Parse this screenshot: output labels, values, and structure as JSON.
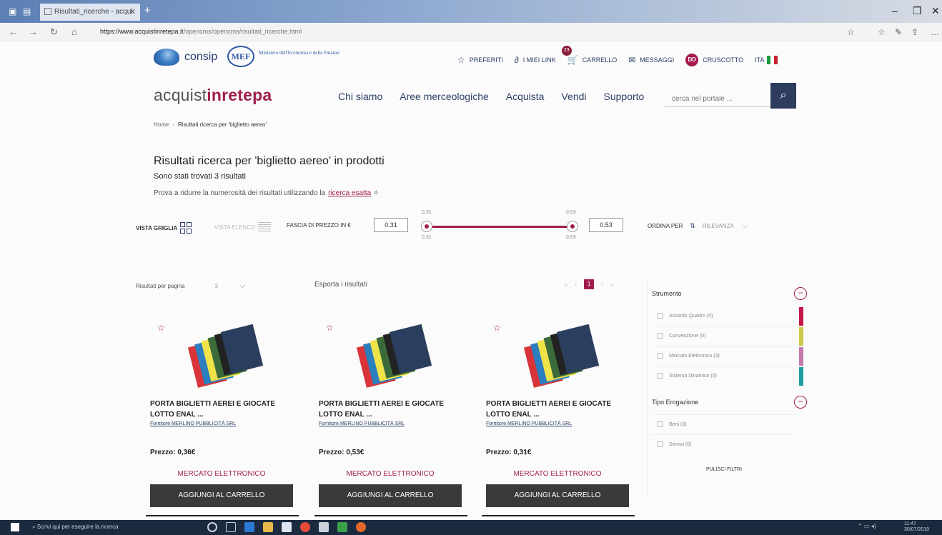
{
  "browser": {
    "tab_title": "Risultati_ricerche - acqui",
    "url_host": "https://www.acquistinretepa.it",
    "url_path": "/opencms/opencms/risultati_ricerche.html"
  },
  "header": {
    "consip": "consip",
    "mef": "MEF",
    "mef_caption": "Ministero dell'Economia e delle Finanze",
    "links": {
      "preferiti": "PREFERITI",
      "link": "I MIEI LINK",
      "carrello": "CARRELLO",
      "carrello_count": "23",
      "messaggi": "MESSAGGI",
      "user_initials": "DD",
      "cruscotto": "CRUSCOTTO",
      "lang": "ITA"
    },
    "brand_a": "acquist",
    "brand_b": "inrete",
    "brand_c": "pa",
    "nav": [
      "Chi siamo",
      "Aree merceologiche",
      "Acquista",
      "Vendi",
      "Supporto"
    ],
    "search_placeholder": "cerca nel portale ..."
  },
  "breadcrumb": {
    "home": "Home",
    "current": "Risultati ricerca per 'biglietto aereo'"
  },
  "results": {
    "title": "Risultati ricerca per 'biglietto aereo' in prodotti",
    "count": "Sono stati trovati 3 risultati",
    "refine_text": "Prova a ridurre la numerosità dei risultati utilizzando la",
    "refine_link": "ricerca esatta"
  },
  "toolbar": {
    "vista_griglia": "VISTA GRIGLIA",
    "vista_elenco": "VISTA ELENCO",
    "fascia": "FASCIA DI PREZZO IN €",
    "price_min": "0.31",
    "price_max": "0.53",
    "min_top": "0,31",
    "min_bottom": "0,31",
    "max_top": "0,53",
    "max_bottom": "0,53",
    "ordina": "ORDINA PER",
    "ordina_value": "RILEVANZA"
  },
  "listing": {
    "per_page_label": "Risultati per pagina",
    "per_page_value": "3",
    "export": "Esporta i risultati",
    "page": "1"
  },
  "products": [
    {
      "name": "PORTA BIGLIETTI AEREI E GIOCATE LOTTO ENAL ...",
      "supplier": "Fornitore MERLINO PUBBLICITÀ SRL",
      "price": "Prezzo: 0,36€",
      "market": "MERCATO ELETTRONICO",
      "add": "AGGIUNGI AL CARRELLO"
    },
    {
      "name": "PORTA BIGLIETTI AEREI E GIOCATE LOTTO ENAL ...",
      "supplier": "Fornitore MERLINO PUBBLICITÀ SRL",
      "price": "Prezzo: 0,53€",
      "market": "MERCATO ELETTRONICO",
      "add": "AGGIUNGI AL CARRELLO"
    },
    {
      "name": "PORTA BIGLIETTI AEREI E GIOCATE LOTTO ENAL ...",
      "supplier": "Fornitore MERLINO PUBBLICITÀ SRL",
      "price": "Prezzo: 0,31€",
      "market": "MERCATO ELETTRONICO",
      "add": "AGGIUNGI AL CARRELLO"
    }
  ],
  "filters": {
    "strumento": "Strumento",
    "strumento_items": [
      "Accordo Quadro (0)",
      "Convenzione (0)",
      "Mercato Elettronico (3)",
      "Sistema Dinamico (0)"
    ],
    "tipo": "Tipo Erogazione",
    "tipo_items": [
      "Beni (3)",
      "Servizi (0)"
    ],
    "pulisci": "PULISCI FILTRI"
  },
  "taskbar": {
    "search": "Scrivi qui per eseguire la ricerca",
    "time": "11:47",
    "date": "30/07/2019"
  },
  "colors": {
    "accent": "#a11d50",
    "navy": "#2c3e66",
    "button": "#3a3a3a"
  }
}
